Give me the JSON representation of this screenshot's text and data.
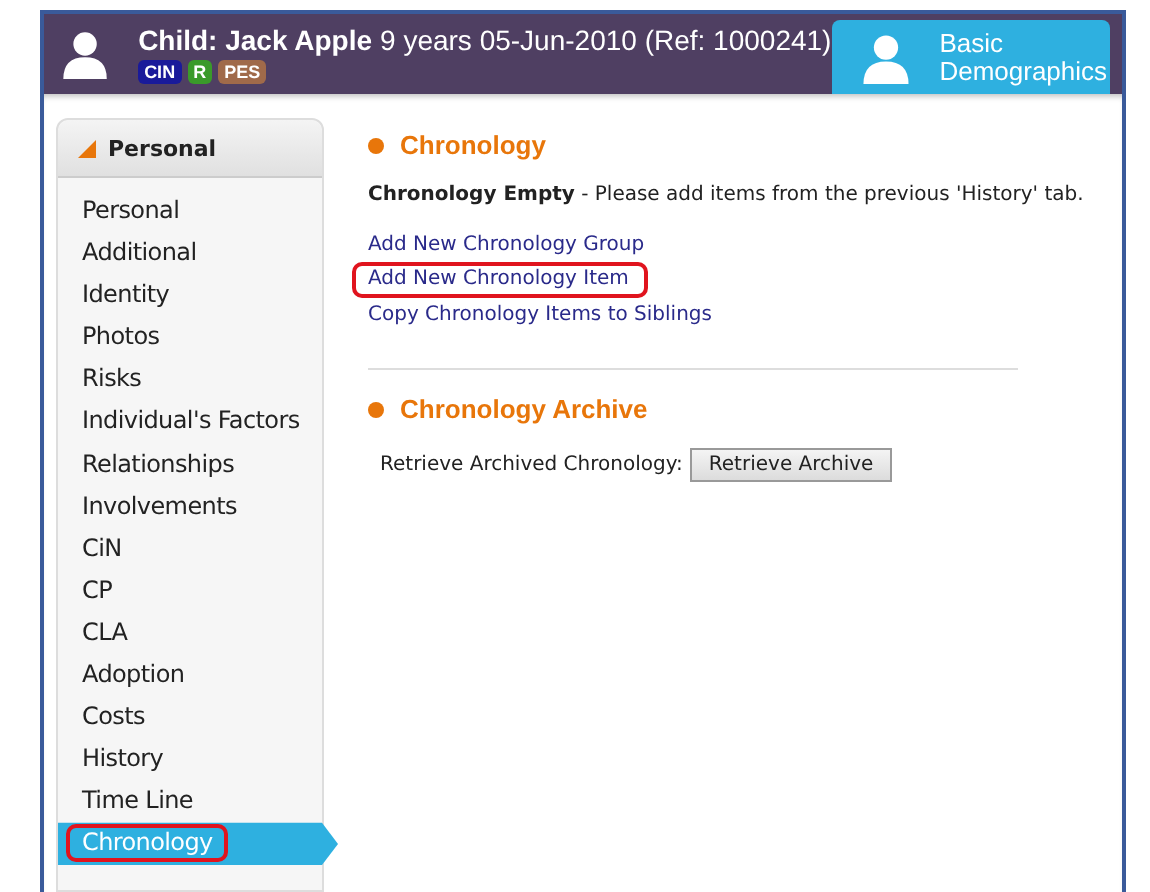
{
  "header": {
    "name_label": "Child: Jack Apple",
    "details": "9 years 05-Jun-2010 (Ref: 1000241)",
    "badges": [
      {
        "text": "CIN",
        "color": "#1a1a9a"
      },
      {
        "text": "R",
        "color": "#3a9a2a"
      },
      {
        "text": "PES",
        "color": "#a06a4a"
      }
    ],
    "tab": {
      "label": "Basic Demographics",
      "selected": true
    }
  },
  "sidebar": {
    "title": "Personal",
    "expanded": true,
    "items": [
      {
        "label": "Personal",
        "selected": false,
        "highlighted": false
      },
      {
        "label": "Additional",
        "selected": false,
        "highlighted": false
      },
      {
        "label": "Identity",
        "selected": false,
        "highlighted": false
      },
      {
        "label": "Photos",
        "selected": false,
        "highlighted": false
      },
      {
        "label": "Risks",
        "selected": false,
        "highlighted": false
      },
      {
        "label": "Individual's Factors",
        "selected": false,
        "highlighted": false
      },
      {
        "label": "Relationships",
        "selected": false,
        "highlighted": false
      },
      {
        "label": "Involvements",
        "selected": false,
        "highlighted": false
      },
      {
        "label": "CiN",
        "selected": false,
        "highlighted": false
      },
      {
        "label": "CP",
        "selected": false,
        "highlighted": false
      },
      {
        "label": "CLA",
        "selected": false,
        "highlighted": false
      },
      {
        "label": "Adoption",
        "selected": false,
        "highlighted": false
      },
      {
        "label": "Costs",
        "selected": false,
        "highlighted": false
      },
      {
        "label": "History",
        "selected": false,
        "highlighted": false
      },
      {
        "label": "Time Line",
        "selected": false,
        "highlighted": false
      },
      {
        "label": "Chronology",
        "selected": true,
        "highlighted": true
      }
    ]
  },
  "chronology": {
    "title": "Chronology",
    "message": "**Chronology Empty** - Please add items from the previous 'History' tab.",
    "links": [
      {
        "label": "Add New Chronology Group",
        "highlighted": false
      },
      {
        "label": "Add New Chronology Item",
        "highlighted": true
      },
      {
        "label": "Copy Chronology Items to Siblings",
        "highlighted": false
      }
    ]
  },
  "archive": {
    "title": "Chronology Archive",
    "label": "Retrieve Archived Chronology:",
    "button": "Retrieve Archive"
  }
}
